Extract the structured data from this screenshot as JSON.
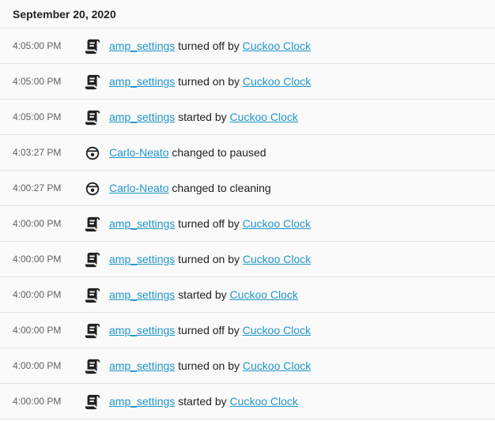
{
  "date_header": "September 20, 2020",
  "entries": [
    {
      "time": "4:05:00 PM",
      "icon": "script-icon",
      "entity": "amp_settings",
      "action": " turned off by ",
      "source": "Cuckoo Clock"
    },
    {
      "time": "4:05:00 PM",
      "icon": "script-icon",
      "entity": "amp_settings",
      "action": " turned on by ",
      "source": "Cuckoo Clock"
    },
    {
      "time": "4:05:00 PM",
      "icon": "script-icon",
      "entity": "amp_settings",
      "action": " started by ",
      "source": "Cuckoo Clock"
    },
    {
      "time": "4:03:27 PM",
      "icon": "robot-vacuum-icon",
      "entity": "Carlo-Neato",
      "action": " changed to paused",
      "source": ""
    },
    {
      "time": "4:00:27 PM",
      "icon": "robot-vacuum-icon",
      "entity": "Carlo-Neato",
      "action": " changed to cleaning",
      "source": ""
    },
    {
      "time": "4:00:00 PM",
      "icon": "script-icon",
      "entity": "amp_settings",
      "action": " turned off by ",
      "source": "Cuckoo Clock"
    },
    {
      "time": "4:00:00 PM",
      "icon": "script-icon",
      "entity": "amp_settings",
      "action": " turned on by ",
      "source": "Cuckoo Clock"
    },
    {
      "time": "4:00:00 PM",
      "icon": "script-icon",
      "entity": "amp_settings",
      "action": " started by ",
      "source": "Cuckoo Clock"
    },
    {
      "time": "4:00:00 PM",
      "icon": "script-icon",
      "entity": "amp_settings",
      "action": " turned off by ",
      "source": "Cuckoo Clock"
    },
    {
      "time": "4:00:00 PM",
      "icon": "script-icon",
      "entity": "amp_settings",
      "action": " turned on by ",
      "source": "Cuckoo Clock"
    },
    {
      "time": "4:00:00 PM",
      "icon": "script-icon",
      "entity": "amp_settings",
      "action": " started by ",
      "source": "Cuckoo Clock"
    }
  ]
}
